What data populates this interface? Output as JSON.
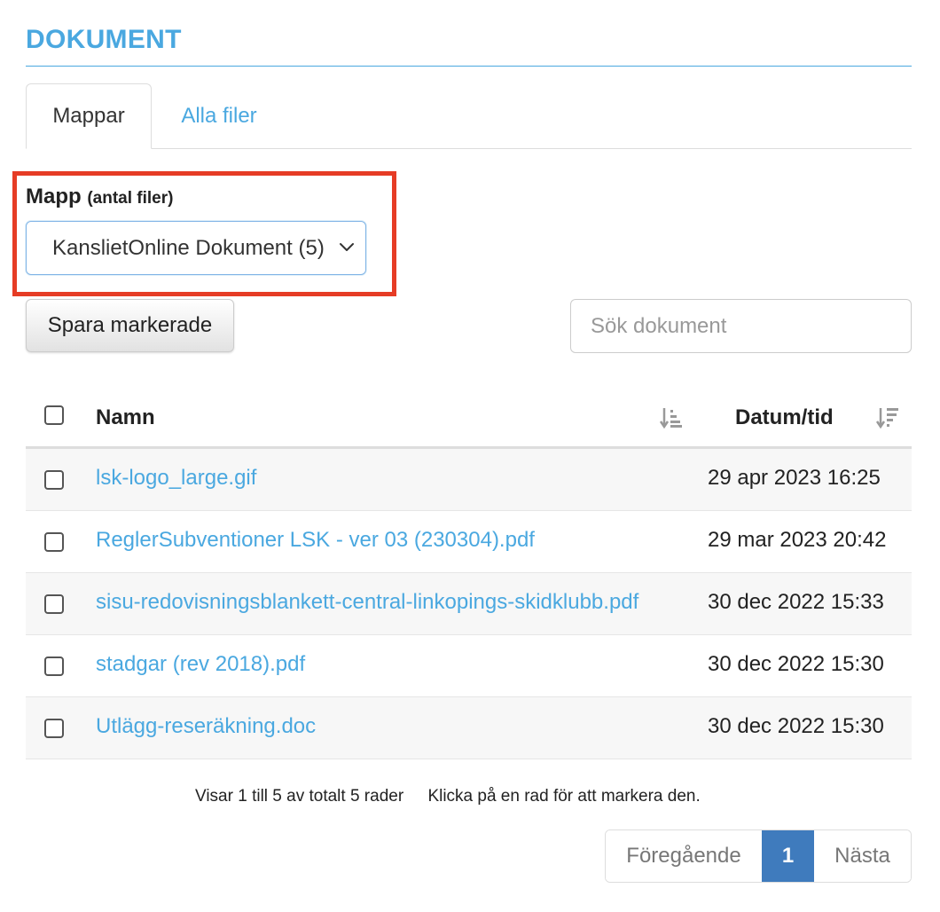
{
  "page": {
    "title": "DOKUMENT"
  },
  "tabs": [
    {
      "label": "Mappar",
      "active": true
    },
    {
      "label": "Alla filer",
      "active": false
    }
  ],
  "folder": {
    "label": "Mapp",
    "label_sub": "(antal filer)",
    "selected": "KanslietOnline Dokument (5)"
  },
  "toolbar": {
    "save_label": "Spara markerade",
    "search_placeholder": "Sök dokument"
  },
  "table": {
    "columns": {
      "name": "Namn",
      "date": "Datum/tid"
    },
    "rows": [
      {
        "name": "lsk-logo_large.gif",
        "date": "29 apr 2023 16:25"
      },
      {
        "name": "ReglerSubventioner LSK - ver 03 (230304).pdf",
        "date": "29 mar 2023 20:42"
      },
      {
        "name": "sisu-redovisningsblankett-central-linkopings-skidklubb.pdf",
        "date": "30 dec 2022 15:33"
      },
      {
        "name": "stadgar (rev 2018).pdf",
        "date": "30 dec 2022 15:30"
      },
      {
        "name": "Utlägg-reseräkning.doc",
        "date": "30 dec 2022 15:30"
      }
    ]
  },
  "info": {
    "count_text": "Visar 1 till 5 av totalt 5 rader",
    "hint_text": "Klicka på en rad för att markera den."
  },
  "pagination": {
    "prev": "Föregående",
    "current": "1",
    "next": "Nästa"
  },
  "colors": {
    "accent": "#4aa8e0",
    "highlight": "#e63c25",
    "page_active": "#3f7bbd"
  }
}
